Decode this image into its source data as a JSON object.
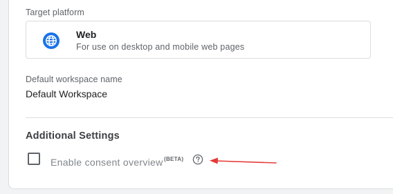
{
  "target_platform": {
    "label": "Target platform",
    "option": {
      "icon": "globe-icon",
      "title": "Web",
      "description": "For use on desktop and mobile web pages"
    }
  },
  "workspace": {
    "label": "Default workspace name",
    "value": "Default Workspace"
  },
  "additional_settings": {
    "title": "Additional Settings",
    "consent": {
      "label": "Enable consent overview",
      "badge": "(BETA)",
      "checked": false,
      "help_icon": "help-circle-icon"
    }
  },
  "annotation": {
    "icon": "red-arrow-icon",
    "color": "#e53935"
  },
  "colors": {
    "accent": "#1a73e8"
  }
}
